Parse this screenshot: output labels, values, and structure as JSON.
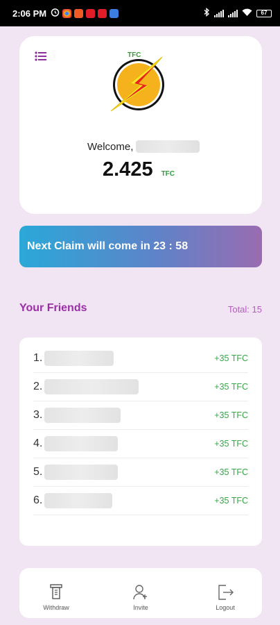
{
  "status_bar": {
    "time": "2:06 PM",
    "battery": "67"
  },
  "header": {
    "logo_text": "TFC",
    "welcome_label": "Welcome,",
    "balance": "2.425",
    "balance_unit": "TFC"
  },
  "claim_banner": {
    "text": "Next Claim will come in 23 : 58"
  },
  "friends": {
    "title": "Your Friends",
    "total_label": "Total: 15",
    "items": [
      {
        "number": "1.",
        "reward": "+35 TFC"
      },
      {
        "number": "2.",
        "reward": "+35 TFC"
      },
      {
        "number": "3.",
        "reward": "+35 TFC"
      },
      {
        "number": "4.",
        "reward": "+35 TFC"
      },
      {
        "number": "5.",
        "reward": "+35 TFC"
      },
      {
        "number": "6.",
        "reward": "+35 TFC"
      }
    ]
  },
  "bottom_nav": {
    "withdraw_label": "Withdraw",
    "invite_label": "Invite",
    "logout_label": "Logout"
  },
  "colors": {
    "background": "#f1e4f3",
    "accent_purple": "#9b2fa8",
    "reward_green": "#38a64a",
    "banner_start": "#2aa8d8",
    "banner_end": "#9a6bb0"
  }
}
